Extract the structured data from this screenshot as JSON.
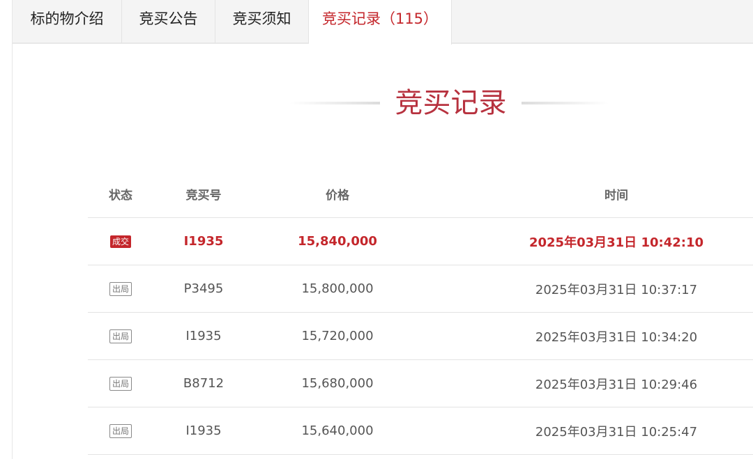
{
  "tabs": [
    {
      "label": "标的物介绍",
      "active": false
    },
    {
      "label": "竞买公告",
      "active": false
    },
    {
      "label": "竞买须知",
      "active": false
    },
    {
      "label": "竞买记录（115）",
      "active": true
    }
  ],
  "section_title": "竞买记录",
  "table": {
    "headers": {
      "status": "状态",
      "code": "竞买号",
      "price": "价格",
      "time": "时间"
    },
    "rows": [
      {
        "status": "成交",
        "code": "I1935",
        "price": "15,840,000",
        "time": "2025年03月31日 10:42:10",
        "winner": true
      },
      {
        "status": "出局",
        "code": "P3495",
        "price": "15,800,000",
        "time": "2025年03月31日 10:37:17",
        "winner": false
      },
      {
        "status": "出局",
        "code": "I1935",
        "price": "15,720,000",
        "time": "2025年03月31日 10:34:20",
        "winner": false
      },
      {
        "status": "出局",
        "code": "B8712",
        "price": "15,680,000",
        "time": "2025年03月31日 10:29:46",
        "winner": false
      },
      {
        "status": "出局",
        "code": "I1935",
        "price": "15,640,000",
        "time": "2025年03月31日 10:25:47",
        "winner": false
      }
    ]
  },
  "colors": {
    "accent": "#c4262b",
    "heading": "#b7323f",
    "tab_bar": "#f4f4f4"
  }
}
